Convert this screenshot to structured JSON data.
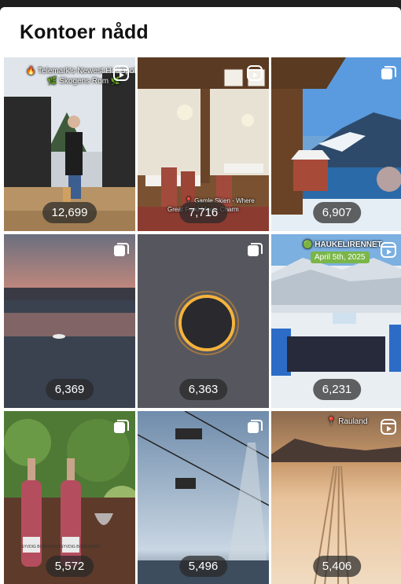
{
  "title": "Kontoer nådd",
  "tiles": [
    {
      "count": "12,699",
      "icon": "reel-icon",
      "overlay_lines": [
        "🔥 Telemark's Newest Hot Spot",
        "🌿 Skogens Rom 🌿"
      ]
    },
    {
      "count": "7,716",
      "icon": "reel-icon",
      "overlay_lines": [
        "📍 Gamle Skien - Where",
        "Great Food Meets Charm"
      ]
    },
    {
      "count": "6,907",
      "icon": "carousel-icon"
    },
    {
      "count": "6,369",
      "icon": "carousel-icon"
    },
    {
      "count": "6,363",
      "icon": "carousel-icon"
    },
    {
      "count": "6,231",
      "icon": "reel-icon",
      "overlay_lines": [
        "🟢 HAUKELIRENNET"
      ],
      "tag": "April 5th, 2025"
    },
    {
      "count": "5,572",
      "icon": "carousel-icon",
      "label_text": "SYVDIG BOBESIDER"
    },
    {
      "count": "5,496",
      "icon": "carousel-icon"
    },
    {
      "count": "5,406",
      "icon": "reel-icon",
      "overlay_lines": [
        "📍 Rauland"
      ]
    }
  ]
}
